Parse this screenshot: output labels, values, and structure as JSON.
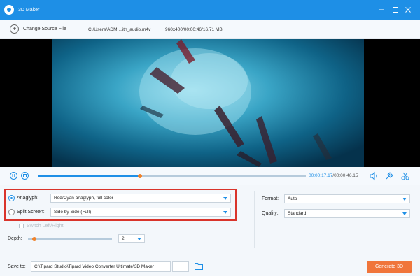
{
  "window": {
    "title": "3D Maker"
  },
  "source": {
    "change_label": "Change Source File",
    "file_path": "C:/Users/ADMI...ith_audio.m4v",
    "file_info": "960x400/00:00:46/16.71 MB"
  },
  "player": {
    "current_time": "00:00:17.17",
    "total_time": "/00:00:46.15",
    "progress_fraction": 0.38
  },
  "settings": {
    "anaglyph_label": "Anaglyph:",
    "anaglyph_value": "Red/Cyan anaglyph, full color",
    "split_label": "Split Screen:",
    "split_value": "Side by Side (Full)",
    "switch_label": "Switch Left/Right",
    "depth_label": "Depth:",
    "depth_value": "2",
    "depth_fraction": 0.05,
    "format_label": "Format:",
    "format_value": "Auto",
    "quality_label": "Quality:",
    "quality_value": "Standard"
  },
  "footer": {
    "save_label": "Save to:",
    "save_path": "C:\\Tipard Studio\\Tipard Video Converter Ultimate\\3D Maker",
    "browse_label": "···",
    "generate_label": "Generate 3D"
  },
  "colors": {
    "accent": "#1e8fe6",
    "orange": "#f0753b",
    "highlight": "#d9342b"
  }
}
